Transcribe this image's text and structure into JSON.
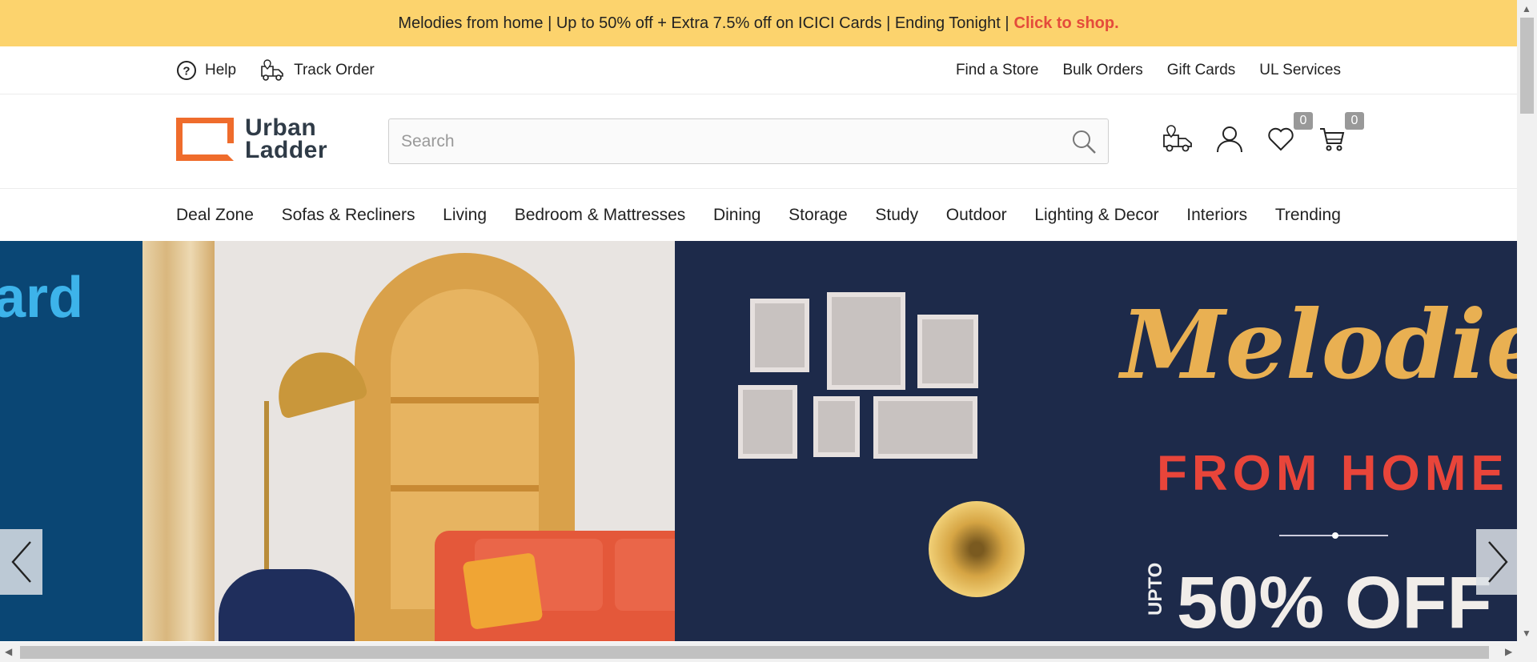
{
  "promo": {
    "text": "Melodies from home | Up to 50% off + Extra 7.5% off on ICICI Cards | Ending Tonight |",
    "cta": "Click to shop."
  },
  "utility": {
    "help": "Help",
    "track_order": "Track Order",
    "links": [
      "Find a Store",
      "Bulk Orders",
      "Gift Cards",
      "UL Services"
    ]
  },
  "logo": {
    "line1": "Urban",
    "line2": "Ladder"
  },
  "search": {
    "placeholder": "Search",
    "value": ""
  },
  "header_icons": {
    "store_locator_icon": "truck-location-icon",
    "account_icon": "user-icon",
    "wishlist_count": "0",
    "cart_count": "0"
  },
  "nav": [
    "Deal Zone",
    "Sofas & Recliners",
    "Living",
    "Bedroom & Mattresses",
    "Dining",
    "Storage",
    "Study",
    "Outdoor",
    "Lighting & Decor",
    "Interiors",
    "Trending"
  ],
  "hero": {
    "left_fragment": "ard",
    "title": "Melodies",
    "subtitle": "FROM HOME",
    "upto": "UPTO",
    "offer": "50% OFF"
  },
  "colors": {
    "promo_bg": "#fcd36d",
    "cta": "#e44b3b",
    "brand_orange": "#ef6c2c",
    "hero_navy": "#1d2a4a",
    "hero_gold": "#e9b052",
    "hero_red": "#e8453a"
  }
}
